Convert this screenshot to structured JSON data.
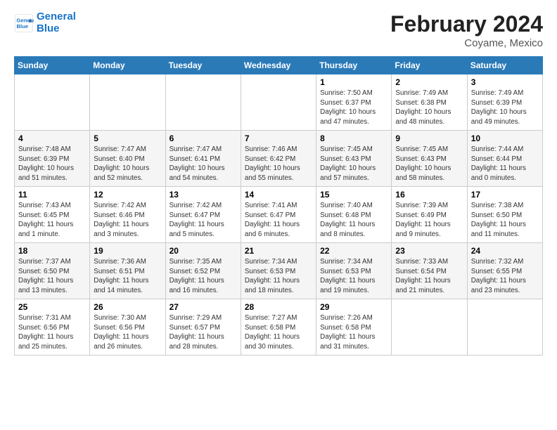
{
  "header": {
    "logo_line1": "General",
    "logo_line2": "Blue",
    "month": "February 2024",
    "location": "Coyame, Mexico"
  },
  "weekdays": [
    "Sunday",
    "Monday",
    "Tuesday",
    "Wednesday",
    "Thursday",
    "Friday",
    "Saturday"
  ],
  "weeks": [
    [
      {
        "day": "",
        "info": ""
      },
      {
        "day": "",
        "info": ""
      },
      {
        "day": "",
        "info": ""
      },
      {
        "day": "",
        "info": ""
      },
      {
        "day": "1",
        "info": "Sunrise: 7:50 AM\nSunset: 6:37 PM\nDaylight: 10 hours\nand 47 minutes."
      },
      {
        "day": "2",
        "info": "Sunrise: 7:49 AM\nSunset: 6:38 PM\nDaylight: 10 hours\nand 48 minutes."
      },
      {
        "day": "3",
        "info": "Sunrise: 7:49 AM\nSunset: 6:39 PM\nDaylight: 10 hours\nand 49 minutes."
      }
    ],
    [
      {
        "day": "4",
        "info": "Sunrise: 7:48 AM\nSunset: 6:39 PM\nDaylight: 10 hours\nand 51 minutes."
      },
      {
        "day": "5",
        "info": "Sunrise: 7:47 AM\nSunset: 6:40 PM\nDaylight: 10 hours\nand 52 minutes."
      },
      {
        "day": "6",
        "info": "Sunrise: 7:47 AM\nSunset: 6:41 PM\nDaylight: 10 hours\nand 54 minutes."
      },
      {
        "day": "7",
        "info": "Sunrise: 7:46 AM\nSunset: 6:42 PM\nDaylight: 10 hours\nand 55 minutes."
      },
      {
        "day": "8",
        "info": "Sunrise: 7:45 AM\nSunset: 6:43 PM\nDaylight: 10 hours\nand 57 minutes."
      },
      {
        "day": "9",
        "info": "Sunrise: 7:45 AM\nSunset: 6:43 PM\nDaylight: 10 hours\nand 58 minutes."
      },
      {
        "day": "10",
        "info": "Sunrise: 7:44 AM\nSunset: 6:44 PM\nDaylight: 11 hours\nand 0 minutes."
      }
    ],
    [
      {
        "day": "11",
        "info": "Sunrise: 7:43 AM\nSunset: 6:45 PM\nDaylight: 11 hours\nand 1 minute."
      },
      {
        "day": "12",
        "info": "Sunrise: 7:42 AM\nSunset: 6:46 PM\nDaylight: 11 hours\nand 3 minutes."
      },
      {
        "day": "13",
        "info": "Sunrise: 7:42 AM\nSunset: 6:47 PM\nDaylight: 11 hours\nand 5 minutes."
      },
      {
        "day": "14",
        "info": "Sunrise: 7:41 AM\nSunset: 6:47 PM\nDaylight: 11 hours\nand 6 minutes."
      },
      {
        "day": "15",
        "info": "Sunrise: 7:40 AM\nSunset: 6:48 PM\nDaylight: 11 hours\nand 8 minutes."
      },
      {
        "day": "16",
        "info": "Sunrise: 7:39 AM\nSunset: 6:49 PM\nDaylight: 11 hours\nand 9 minutes."
      },
      {
        "day": "17",
        "info": "Sunrise: 7:38 AM\nSunset: 6:50 PM\nDaylight: 11 hours\nand 11 minutes."
      }
    ],
    [
      {
        "day": "18",
        "info": "Sunrise: 7:37 AM\nSunset: 6:50 PM\nDaylight: 11 hours\nand 13 minutes."
      },
      {
        "day": "19",
        "info": "Sunrise: 7:36 AM\nSunset: 6:51 PM\nDaylight: 11 hours\nand 14 minutes."
      },
      {
        "day": "20",
        "info": "Sunrise: 7:35 AM\nSunset: 6:52 PM\nDaylight: 11 hours\nand 16 minutes."
      },
      {
        "day": "21",
        "info": "Sunrise: 7:34 AM\nSunset: 6:53 PM\nDaylight: 11 hours\nand 18 minutes."
      },
      {
        "day": "22",
        "info": "Sunrise: 7:34 AM\nSunset: 6:53 PM\nDaylight: 11 hours\nand 19 minutes."
      },
      {
        "day": "23",
        "info": "Sunrise: 7:33 AM\nSunset: 6:54 PM\nDaylight: 11 hours\nand 21 minutes."
      },
      {
        "day": "24",
        "info": "Sunrise: 7:32 AM\nSunset: 6:55 PM\nDaylight: 11 hours\nand 23 minutes."
      }
    ],
    [
      {
        "day": "25",
        "info": "Sunrise: 7:31 AM\nSunset: 6:56 PM\nDaylight: 11 hours\nand 25 minutes."
      },
      {
        "day": "26",
        "info": "Sunrise: 7:30 AM\nSunset: 6:56 PM\nDaylight: 11 hours\nand 26 minutes."
      },
      {
        "day": "27",
        "info": "Sunrise: 7:29 AM\nSunset: 6:57 PM\nDaylight: 11 hours\nand 28 minutes."
      },
      {
        "day": "28",
        "info": "Sunrise: 7:27 AM\nSunset: 6:58 PM\nDaylight: 11 hours\nand 30 minutes."
      },
      {
        "day": "29",
        "info": "Sunrise: 7:26 AM\nSunset: 6:58 PM\nDaylight: 11 hours\nand 31 minutes."
      },
      {
        "day": "",
        "info": ""
      },
      {
        "day": "",
        "info": ""
      }
    ]
  ]
}
